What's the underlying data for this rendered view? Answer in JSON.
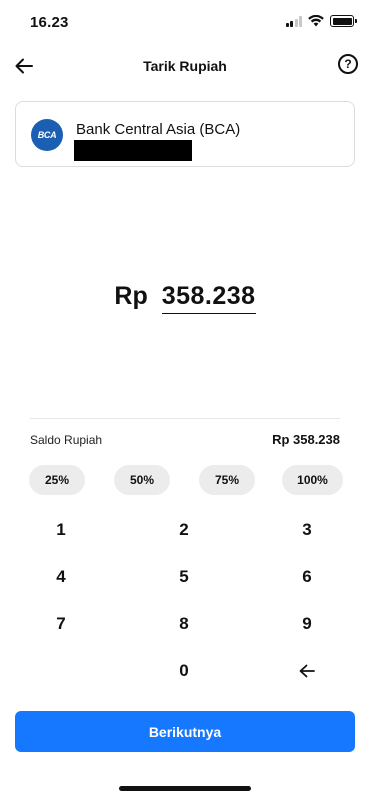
{
  "status_bar": {
    "time": "16.23",
    "icons": [
      "cellular-signal-icon",
      "wifi-icon",
      "battery-icon"
    ]
  },
  "header": {
    "title": "Tarik Rupiah",
    "back_icon": "arrow-left-icon",
    "help_label": "?"
  },
  "bank": {
    "logo_text": "BCA",
    "name": "Bank Central Asia (BCA)",
    "logo_color": "#1a5fb4"
  },
  "amount": {
    "currency": "Rp",
    "value": "358.238"
  },
  "balance": {
    "label": "Saldo Rupiah",
    "value": "Rp 358.238"
  },
  "percent_options": [
    "25%",
    "50%",
    "75%",
    "100%"
  ],
  "keypad": {
    "keys": [
      "1",
      "2",
      "3",
      "4",
      "5",
      "6",
      "7",
      "8",
      "9",
      "0"
    ],
    "backspace_icon": "backspace-arrow-icon"
  },
  "primary_button": {
    "label": "Berikutnya",
    "color": "#1677ff"
  }
}
